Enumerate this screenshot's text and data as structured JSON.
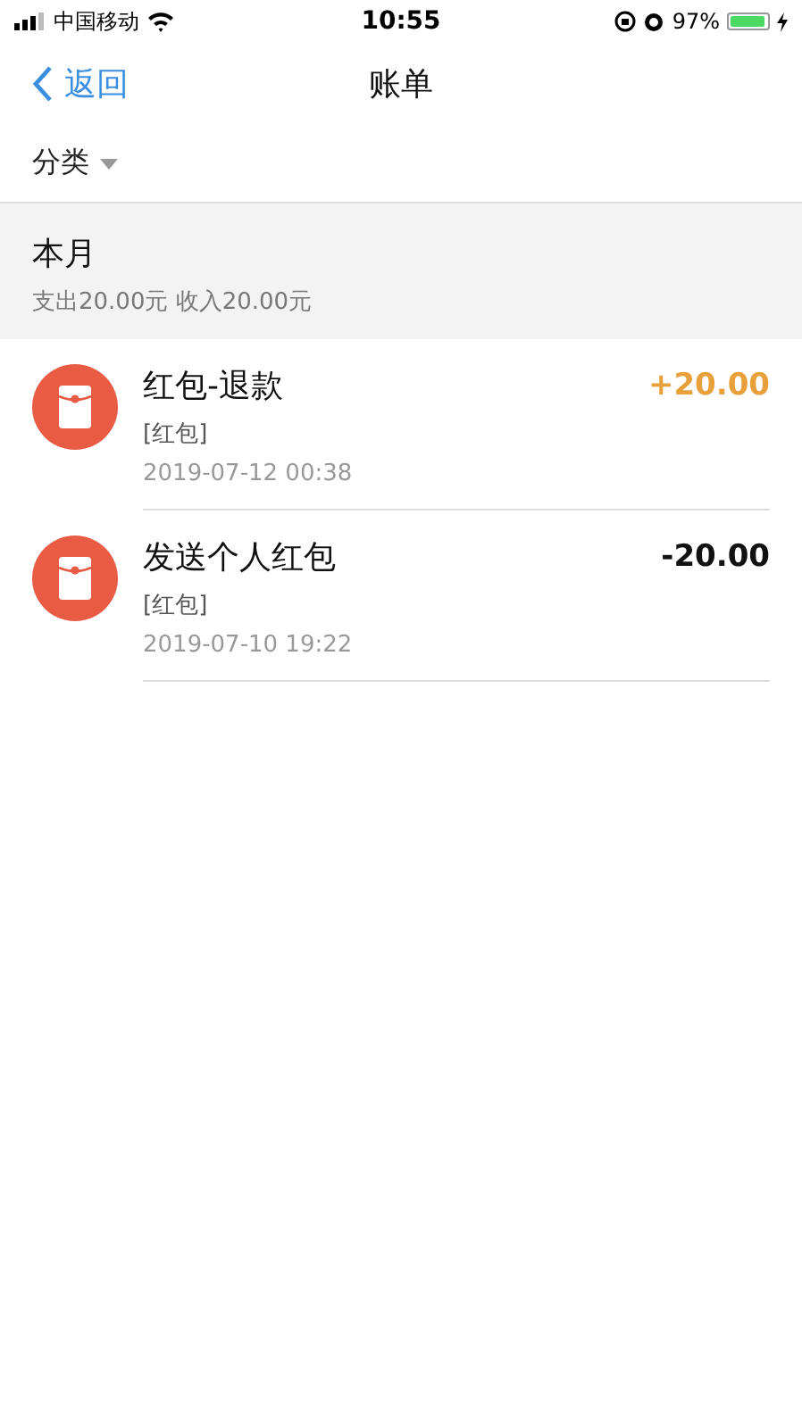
{
  "status_bar": {
    "carrier": "中国移动",
    "time": "10:55",
    "battery": "97%"
  },
  "nav": {
    "back": "返回",
    "title": "账单"
  },
  "filter": {
    "label": "分类"
  },
  "month": {
    "title": "本月",
    "summary": "支出20.00元 收入20.00元"
  },
  "transactions": [
    {
      "title": "红包-退款",
      "category": "[红包]",
      "time": "2019-07-12 00:38",
      "amount": "+20.00",
      "kind": "income"
    },
    {
      "title": "发送个人红包",
      "category": "[红包]",
      "time": "2019-07-10 19:22",
      "amount": "-20.00",
      "kind": "expense"
    }
  ]
}
